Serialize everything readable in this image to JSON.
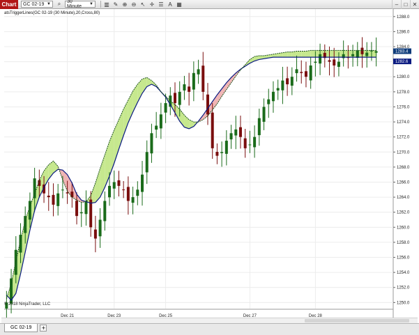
{
  "toolbar": {
    "chart_tab": "Chart",
    "instrument": "GC 02-19",
    "interval": "30 Minute",
    "icons": [
      "search-icon",
      "bar-chart-icon",
      "pencil-icon",
      "zoom-icon",
      "zoom-out-icon",
      "pointer-icon",
      "crosshair-icon",
      "properties-icon",
      "text-icon",
      "data-box-icon"
    ],
    "window_buttons": [
      "minimize-icon",
      "maximize-icon",
      "close-icon"
    ]
  },
  "indicator_label": "atsTriggerLines(GC 02-19 (30 Minute),20,Cross,80)",
  "copyright": "© 2018 NinjaTrader, LLC",
  "tabs": {
    "instrument_tab": "GC 02-19",
    "add_label": "+"
  },
  "colors": {
    "up": "#1a6b1a",
    "down": "#7a0e0e",
    "band_up": "#c6e88e",
    "band_down": "#f0b4b4",
    "fast_line": "#1a4f1a",
    "slow_line": "#0a1a80"
  },
  "chart_data": {
    "type": "candlestick",
    "ylim": [
      1249.2,
      1289.0
    ],
    "y_ticks": [
      1250.0,
      1252.0,
      1254.0,
      1256.0,
      1258.0,
      1260.0,
      1262.0,
      1264.0,
      1266.0,
      1268.0,
      1270.0,
      1272.0,
      1274.0,
      1276.0,
      1278.0,
      1280.0,
      1282.0,
      1284.0,
      1286.0,
      1288.0
    ],
    "x_labels": [
      {
        "label": "Dec 21",
        "x": 13
      },
      {
        "label": "Dec 23",
        "x": 23
      },
      {
        "label": "Dec 25",
        "x": 34
      },
      {
        "label": "Dec 27",
        "x": 52
      },
      {
        "label": "Dec 28",
        "x": 66
      }
    ],
    "x_count": 80,
    "last_price": 1283.4,
    "last_price_label": "1283.4",
    "slow_price": 1282.6,
    "slow_price_label": "1282.6",
    "close": [
      1250.0,
      1253.2,
      1257.0,
      1259.0,
      1261.5,
      1263.5,
      1266.5,
      1265.5,
      1264.5,
      1264.0,
      1263.0,
      1264.5,
      1265.0,
      1264.5,
      1264.0,
      1261.5,
      1262.0,
      1263.5,
      1260.0,
      1258.5,
      1261.0,
      1263.5,
      1265.5,
      1266.0,
      1265.5,
      1265.0,
      1263.5,
      1264.0,
      1265.0,
      1267.0,
      1270.0,
      1272.5,
      1273.5,
      1275.0,
      1276.5,
      1277.5,
      1276.5,
      1278.0,
      1279.0,
      1278.0,
      1280.5,
      1281.0,
      1278.0,
      1275.0,
      1270.5,
      1269.5,
      1270.0,
      1271.5,
      1272.5,
      1273.0,
      1272.0,
      1270.5,
      1271.0,
      1272.0,
      1274.5,
      1276.0,
      1277.0,
      1278.0,
      1278.5,
      1279.5,
      1279.0,
      1280.0,
      1281.0,
      1280.5,
      1280.0,
      1281.5,
      1282.0,
      1283.0,
      1282.5,
      1282.0,
      1281.5,
      1282.0,
      1283.0,
      1282.5,
      1283.0,
      1283.5,
      1283.0,
      1283.2,
      1283.5,
      1283.4
    ],
    "fast": [
      1250.5,
      1252.5,
      1255.5,
      1258.3,
      1260.9,
      1262.8,
      1264.4,
      1266.2,
      1267.5,
      1268.3,
      1268.8,
      1268.1,
      1266.3,
      1264.8,
      1264.0,
      1263.6,
      1263.3,
      1263.4,
      1264.2,
      1265.9,
      1267.8,
      1269.6,
      1271.4,
      1272.9,
      1274.3,
      1275.7,
      1276.9,
      1278.1,
      1279.0,
      1279.7,
      1279.9,
      1279.5,
      1278.9,
      1278.0,
      1277.4,
      1276.8,
      1276.3,
      1275.7,
      1274.9,
      1274.3,
      1274.0,
      1274.0,
      1274.3,
      1274.8,
      1275.6,
      1276.4,
      1277.4,
      1278.3,
      1279.2,
      1280.1,
      1280.9,
      1281.6,
      1282.3,
      1282.7,
      1282.8,
      1282.8,
      1282.9,
      1283.0,
      1283.1,
      1283.2,
      1283.3,
      1283.3,
      1283.4,
      1283.4,
      1283.4,
      1283.5,
      1283.5,
      1283.5,
      1283.5,
      1283.5,
      1283.5,
      1283.5,
      1283.5,
      1283.5,
      1283.5,
      1283.5,
      1283.5,
      1283.5,
      1283.5,
      1283.5
    ],
    "slow": [
      1251.0,
      1250.3,
      1251.2,
      1253.8,
      1256.7,
      1259.6,
      1262.2,
      1264.0,
      1265.3,
      1266.4,
      1267.2,
      1267.7,
      1267.6,
      1267.0,
      1265.9,
      1264.4,
      1263.6,
      1263.4,
      1263.2,
      1263.3,
      1264.0,
      1265.3,
      1266.8,
      1268.5,
      1270.4,
      1272.2,
      1273.9,
      1275.3,
      1276.6,
      1277.8,
      1278.7,
      1279.0,
      1278.7,
      1278.0,
      1277.3,
      1276.3,
      1275.2,
      1274.1,
      1273.3,
      1273.1,
      1273.4,
      1274.1,
      1274.9,
      1275.8,
      1276.7,
      1277.6,
      1278.4,
      1279.2,
      1279.9,
      1280.5,
      1281.0,
      1281.4,
      1281.8,
      1282.1,
      1282.3,
      1282.4,
      1282.5,
      1282.6,
      1282.6,
      1282.6,
      1282.6,
      1282.6,
      1282.6,
      1282.6,
      1282.6,
      1282.6,
      1282.6,
      1282.6,
      1282.6,
      1282.6,
      1282.6,
      1282.6,
      1282.6,
      1282.6,
      1282.6,
      1282.6,
      1282.6,
      1282.6,
      1282.6,
      1282.6
    ]
  }
}
